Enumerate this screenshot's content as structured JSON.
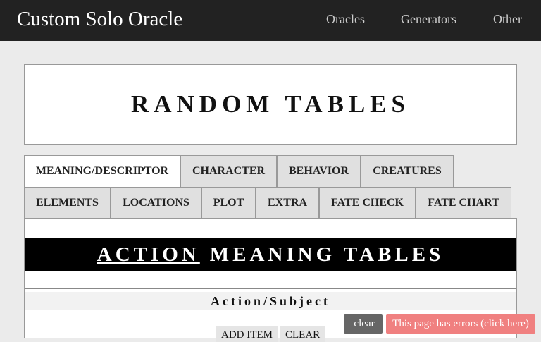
{
  "nav": {
    "brand": "Custom Solo Oracle",
    "items": [
      "Oracles",
      "Generators",
      "Other"
    ]
  },
  "header": {
    "title": "RANDOM TABLES"
  },
  "tabs": {
    "row1": [
      "MEANING/DESCRIPTOR",
      "CHARACTER",
      "BEHAVIOR",
      "CREATURES"
    ],
    "row2": [
      "ELEMENTS",
      "LOCATIONS",
      "PLOT",
      "EXTRA",
      "FATE CHECK",
      "FATE CHART"
    ],
    "active": "MEANING/DESCRIPTOR"
  },
  "section": {
    "title_link": "ACTION",
    "title_rest": "MEANING TABLES",
    "subhead": "Action/Subject",
    "add_item": "ADD ITEM",
    "clear": "CLEAR"
  },
  "overlay": {
    "clear_icon": "trash-icon",
    "clear_glyph": "",
    "clear_label": "clear",
    "errors": "This page has errors (click here)"
  },
  "colors": {
    "navbar": "#222222",
    "active_tab": "#ffffff",
    "inactive_tab": "#e0e0e0",
    "error_pill": "#f08080",
    "clear_pill": "#666666"
  }
}
